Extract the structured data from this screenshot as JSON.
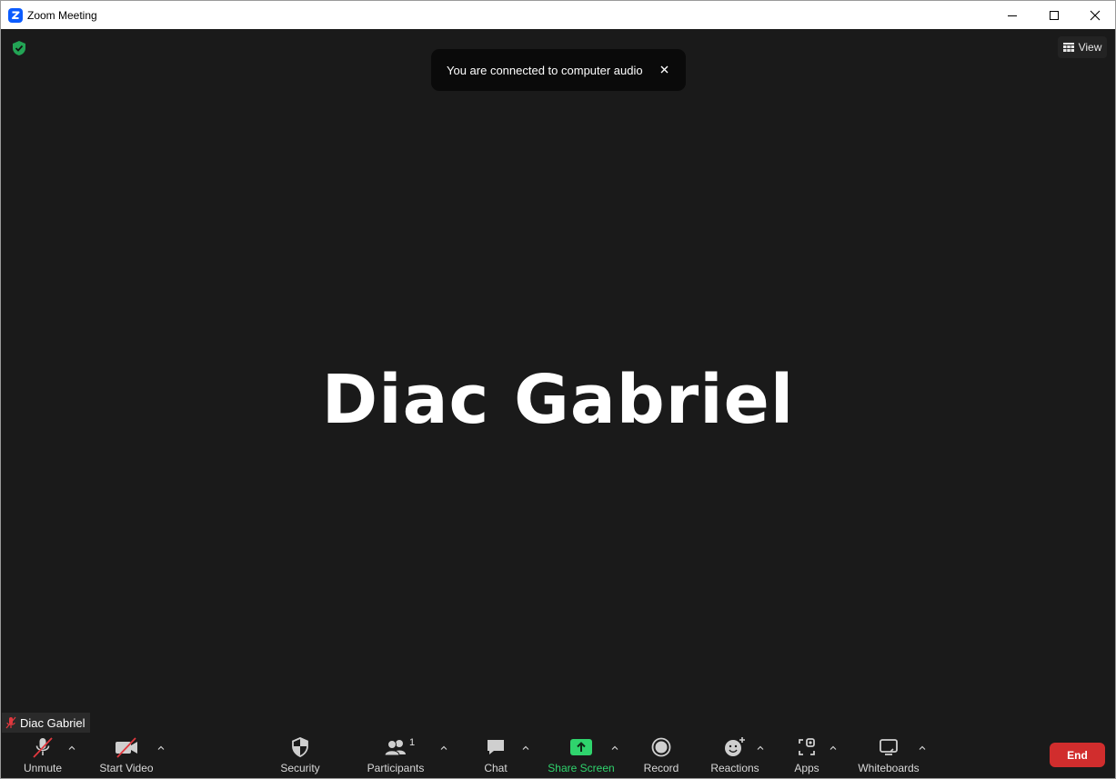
{
  "window": {
    "title": "Zoom Meeting"
  },
  "notification": {
    "text": "You are connected to computer audio"
  },
  "view_button": {
    "label": "View"
  },
  "participant": {
    "display_name": "Diac Gabriel",
    "name_tag": "Diac Gabriel"
  },
  "toolbar": {
    "unmute": "Unmute",
    "start_video": "Start Video",
    "security": "Security",
    "participants": "Participants",
    "participants_count": "1",
    "chat": "Chat",
    "share_screen": "Share Screen",
    "record": "Record",
    "reactions": "Reactions",
    "apps": "Apps",
    "whiteboards": "Whiteboards",
    "end": "End"
  },
  "colors": {
    "background": "#1a1a1a",
    "share_green": "#2fd46d",
    "end_red": "#d12d2d",
    "zoom_blue": "#0b5cff",
    "muted_red": "#e0383e"
  }
}
